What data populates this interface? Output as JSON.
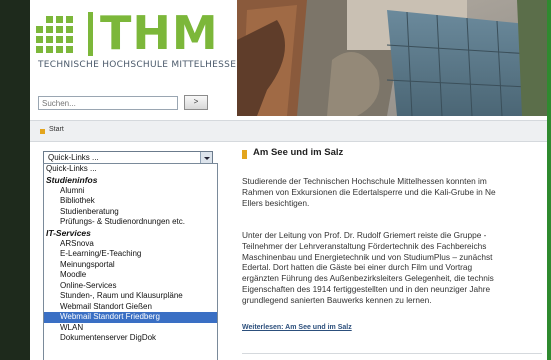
{
  "header": {
    "logo_word": "THM",
    "logo_subtitle": "TECHNISCHE HOCHSCHULE MITTELHESSEN",
    "search_placeholder": "Suchen...",
    "search_button_label": ">"
  },
  "breadcrumb": {
    "label": "Start"
  },
  "quick_links": {
    "selected_label": "Quick-Links ...",
    "items": [
      {
        "kind": "option",
        "label": "Quick-Links ..."
      },
      {
        "kind": "group",
        "label": "Studieninfos"
      },
      {
        "kind": "option",
        "label": "Alumni"
      },
      {
        "kind": "option",
        "label": "Bibliothek"
      },
      {
        "kind": "option",
        "label": "Studienberatung"
      },
      {
        "kind": "option",
        "label": "Prüfungs- & Studienordnungen etc."
      },
      {
        "kind": "group",
        "label": "IT-Services"
      },
      {
        "kind": "option",
        "label": "ARSnova"
      },
      {
        "kind": "option",
        "label": "E-Learning/E-Teaching"
      },
      {
        "kind": "option",
        "label": "Meinungsportal"
      },
      {
        "kind": "option",
        "label": "Moodle"
      },
      {
        "kind": "option",
        "label": "Online-Services"
      },
      {
        "kind": "option",
        "label": "Stunden-, Raum und Klausurpläne"
      },
      {
        "kind": "option",
        "label": "Webmail Standort Gießen"
      },
      {
        "kind": "option",
        "label": "Webmail Standort Friedberg",
        "highlighted": true
      },
      {
        "kind": "option",
        "label": "WLAN"
      },
      {
        "kind": "option",
        "label": "Dokumentenserver DigDok"
      }
    ]
  },
  "article": {
    "title": "Am See und im Salz",
    "paragraph1": [
      "Studierende der Technischen Hochschule Mittelhessen konnten im",
      "Rahmen von Exkursionen die Edertalsperre und die Kali-Grube in Ne",
      "Ellers besichtigen."
    ],
    "paragraph2": [
      "Unter der Leitung von Prof. Dr. Rudolf Griemert reiste die Gruppe -",
      "Teilnehmer der Lehrveranstaltung Fördertechnik des Fachbereichs",
      "Maschinenbau und Energietechnik und von StudiumPlus – zunächst",
      "Edertal. Dort hatten die Gäste bei einer durch Film und Vortrag",
      "ergänzten Führung des Außenbezirksleiters Gelegenheit, die technis",
      "Eigenschaften des 1914 fertiggestellten und in den neunziger Jahre",
      "grundlegend sanierten Bauwerks kennen zu lernen."
    ],
    "read_more": "Weiterlesen: Am See und im Salz"
  },
  "colors": {
    "brand_green": "#7cb73a",
    "accent_orange": "#e3a51d",
    "selection_blue": "#3a6fc4",
    "link_blue": "#2c4f7c"
  }
}
